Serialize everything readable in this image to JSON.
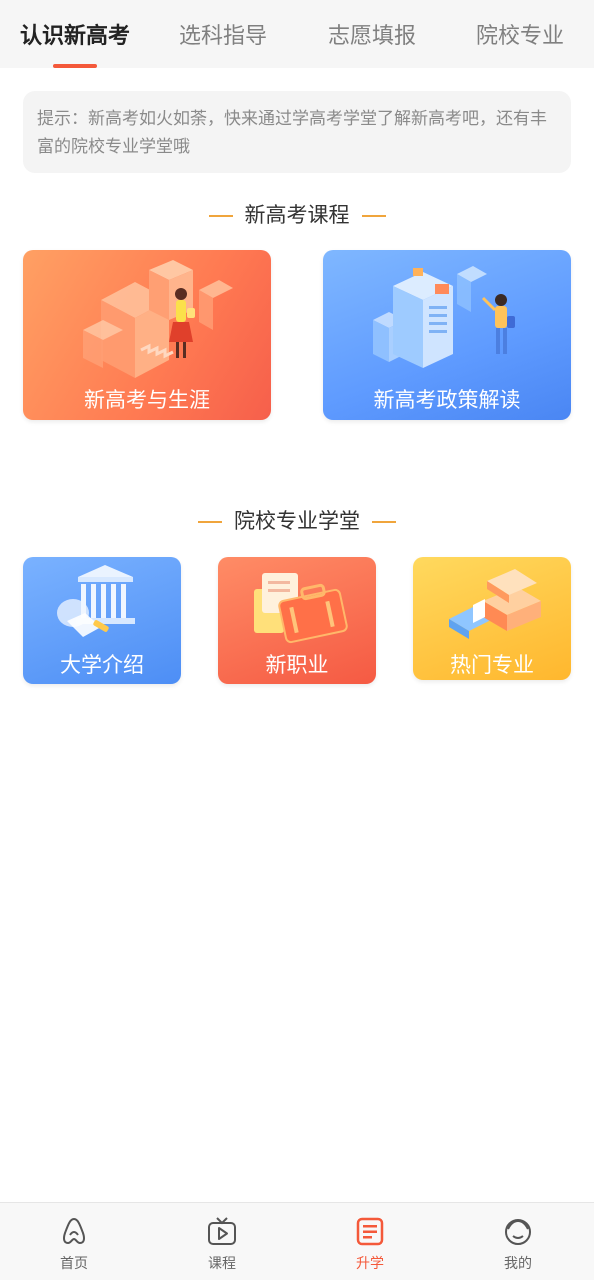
{
  "tabs": [
    {
      "label": "认识新高考",
      "active": true
    },
    {
      "label": "选科指导",
      "active": false
    },
    {
      "label": "志愿填报",
      "active": false
    },
    {
      "label": "院校专业",
      "active": false
    }
  ],
  "tip": {
    "text": "提示：新高考如火如荼，快来通过学高考学堂了解新高考吧，还有丰富的院校专业学堂哦"
  },
  "section_courses": {
    "title": "新高考课程",
    "cards": [
      {
        "label": "新高考与生涯",
        "color": "#ff7a52"
      },
      {
        "label": "新高考政策解读",
        "color": "#5f9bff"
      }
    ]
  },
  "section_schools": {
    "title": "院校专业学堂",
    "cards": [
      {
        "label": "大学介绍",
        "color": "#5b97f7"
      },
      {
        "label": "新职业",
        "color": "#f8684a"
      },
      {
        "label": "热门专业",
        "color": "#ffc23e"
      }
    ]
  },
  "bottom_nav": [
    {
      "label": "首页",
      "icon": "home-icon",
      "active": false
    },
    {
      "label": "课程",
      "icon": "video-icon",
      "active": false
    },
    {
      "label": "升学",
      "icon": "document-icon",
      "active": true
    },
    {
      "label": "我的",
      "icon": "face-icon",
      "active": false
    }
  ],
  "colors": {
    "accent": "#f4593a",
    "section_dash": "#f0a53c"
  }
}
